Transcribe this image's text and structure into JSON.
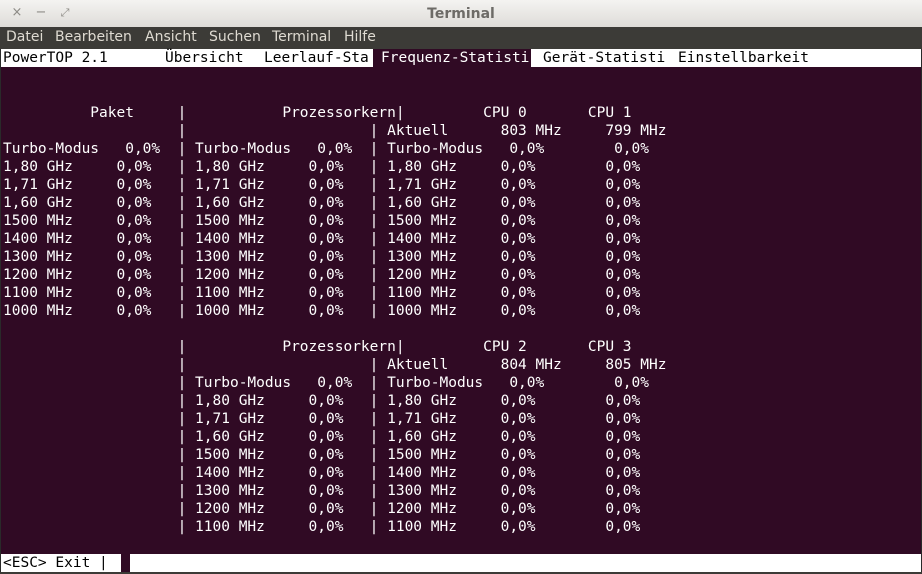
{
  "window": {
    "title": "Terminal",
    "close_glyph": "×",
    "min_glyph": "−",
    "max_glyph": "⤢"
  },
  "menu": [
    "Datei",
    "Bearbeiten",
    "Ansicht",
    "Suchen",
    "Terminal",
    "Hilfe"
  ],
  "app": "PowerTOP 2.1",
  "tabs": [
    {
      "label": "Übersicht",
      "active": false
    },
    {
      "label": "Leerlauf-Sta",
      "active": false
    },
    {
      "label": "Frequenz-Statisti",
      "active": true
    },
    {
      "label": "Gerät-Statisti",
      "active": false
    },
    {
      "label": "Einstellbarkeit",
      "active": false
    }
  ],
  "lines": [
    "",
    "",
    "          Paket     |           Prozessorkern|         CPU 0       CPU 1",
    "                    |                     | Aktuell      803 MHz     799 MHz",
    "Turbo-Modus   0,0%  | Turbo-Modus   0,0%  | Turbo-Modus   0,0%        0,0%",
    "1,80 GHz     0,0%   | 1,80 GHz     0,0%   | 1,80 GHz     0,0%        0,0%",
    "1,71 GHz     0,0%   | 1,71 GHz     0,0%   | 1,71 GHz     0,0%        0,0%",
    "1,60 GHz     0,0%   | 1,60 GHz     0,0%   | 1,60 GHz     0,0%        0,0%",
    "1500 MHz     0,0%   | 1500 MHz     0,0%   | 1500 MHz     0,0%        0,0%",
    "1400 MHz     0,0%   | 1400 MHz     0,0%   | 1400 MHz     0,0%        0,0%",
    "1300 MHz     0,0%   | 1300 MHz     0,0%   | 1300 MHz     0,0%        0,0%",
    "1200 MHz     0,0%   | 1200 MHz     0,0%   | 1200 MHz     0,0%        0,0%",
    "1100 MHz     0,0%   | 1100 MHz     0,0%   | 1100 MHz     0,0%        0,0%",
    "1000 MHz     0,0%   | 1000 MHz     0,0%   | 1000 MHz     0,0%        0,0%",
    "",
    "                    |           Prozessorkern|         CPU 2       CPU 3",
    "                    |                     | Aktuell      804 MHz     805 MHz",
    "                    | Turbo-Modus   0,0%  | Turbo-Modus   0,0%        0,0%",
    "                    | 1,80 GHz     0,0%   | 1,80 GHz     0,0%        0,0%",
    "                    | 1,71 GHz     0,0%   | 1,71 GHz     0,0%        0,0%",
    "                    | 1,60 GHz     0,0%   | 1,60 GHz     0,0%        0,0%",
    "                    | 1500 MHz     0,0%   | 1500 MHz     0,0%        0,0%",
    "                    | 1400 MHz     0,0%   | 1400 MHz     0,0%        0,0%",
    "                    | 1300 MHz     0,0%   | 1300 MHz     0,0%        0,0%",
    "                    | 1200 MHz     0,0%   | 1200 MHz     0,0%        0,0%",
    "                    | 1100 MHz     0,0%   | 1100 MHz     0,0%        0,0%"
  ],
  "status": "<ESC> Exit |"
}
